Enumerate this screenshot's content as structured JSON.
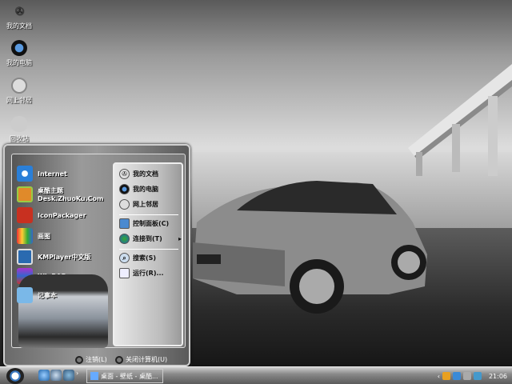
{
  "desktop": {
    "icons": [
      {
        "label": "我的文档",
        "icon": "mercedes-logo-icon"
      },
      {
        "label": "我的电脑",
        "icon": "bmw-logo-icon"
      },
      {
        "label": "网上邻居",
        "icon": "buick-logo-icon"
      },
      {
        "label": "回收站",
        "icon": "toyota-logo-icon"
      }
    ]
  },
  "start_menu": {
    "pinned": [
      {
        "label": "Internet",
        "icon": "internet-explorer-icon"
      },
      {
        "label": "桌酷主题",
        "sublabel": "Desk.ZhuoKu.Com",
        "icon": "zhuoku-theme-icon"
      },
      {
        "label": "IconPackager",
        "icon": "iconpackager-icon"
      },
      {
        "label": "画图",
        "icon": "paint-icon"
      },
      {
        "label": "KMPlayer中文版",
        "icon": "kmplayer-icon"
      },
      {
        "label": "WinRAR",
        "icon": "winrar-icon"
      },
      {
        "label": "记事本",
        "icon": "notepad-icon"
      }
    ],
    "places": [
      {
        "label": "我的文档",
        "icon": "mercedes-logo-icon"
      },
      {
        "label": "我的电脑",
        "icon": "bmw-logo-icon"
      },
      {
        "label": "网上邻居",
        "icon": "buick-logo-icon"
      }
    ],
    "system": [
      {
        "label": "控制面板(C)",
        "icon": "control-panel-icon"
      },
      {
        "label": "连接到(T)",
        "icon": "connect-icon",
        "submenu": "▸"
      }
    ],
    "tools": [
      {
        "label": "搜索(S)",
        "icon": "search-icon"
      },
      {
        "label": "运行(R)...",
        "icon": "run-icon"
      }
    ],
    "logoff": "注销(L)",
    "shutdown": "关闭计算机(U)"
  },
  "taskbar": {
    "task_label": "桌面 - 壁纸 - 桌酷...",
    "tray_expand": "‹",
    "clock": "21:06"
  },
  "colors": {
    "accent": "#3a78c0"
  }
}
